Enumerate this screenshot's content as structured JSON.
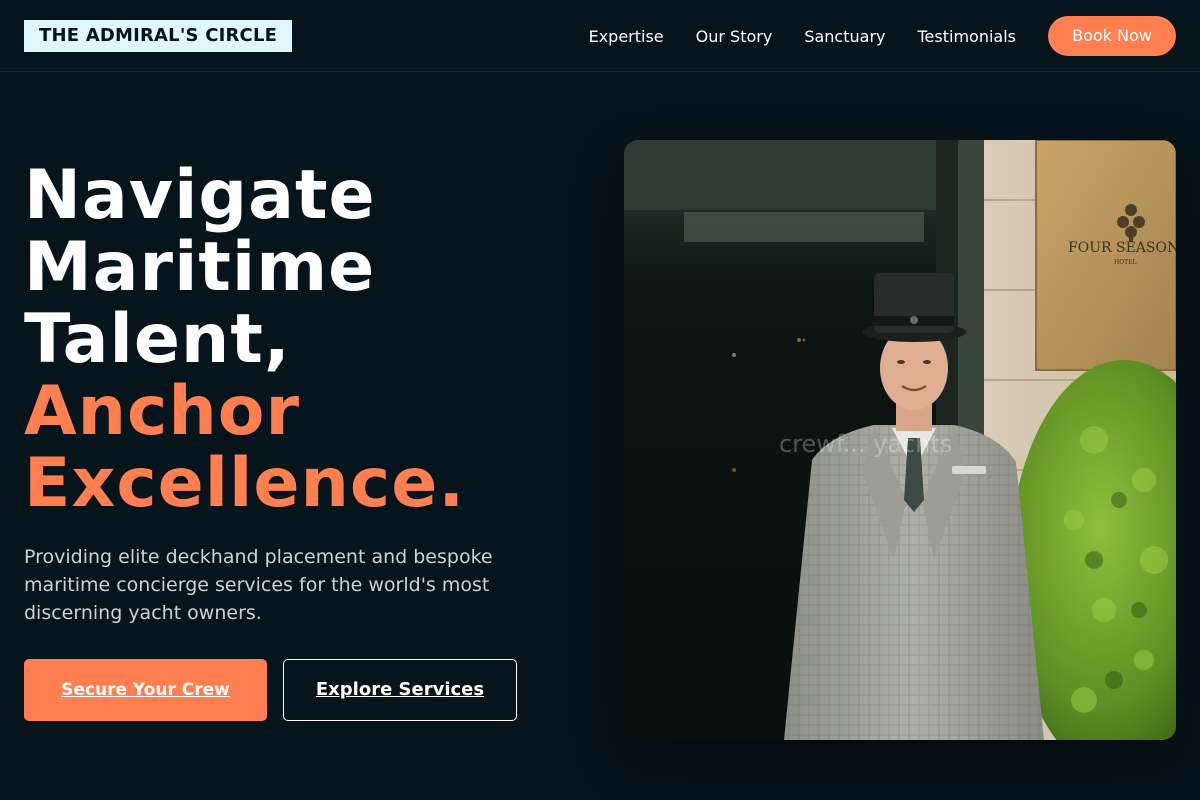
{
  "brand": {
    "logo_text": "THE ADMIRAL'S CIRCLE"
  },
  "nav": {
    "items": [
      "Expertise",
      "Our Story",
      "Sanctuary",
      "Testimonials"
    ],
    "cta_label": "Book Now"
  },
  "hero": {
    "headline_lines": [
      "Navigate",
      "Maritime",
      "Talent,"
    ],
    "headline_accent_lines": [
      "Anchor",
      "Excellence."
    ],
    "subtitle": "Providing elite deckhand placement and bespoke maritime concierge services for the world's most discerning yacht owners.",
    "primary_button": "Secure Your Crew",
    "secondary_button": "Explore Services",
    "image": {
      "sign_text": "FOUR SEASONS",
      "sign_subtext": "HOTEL",
      "watermark": "crewf... yachts"
    }
  },
  "colors": {
    "background": "#06141b",
    "accent": "#ff7f50",
    "logo_bg": "#dff7fb",
    "text_muted": "#c9d3d8"
  }
}
